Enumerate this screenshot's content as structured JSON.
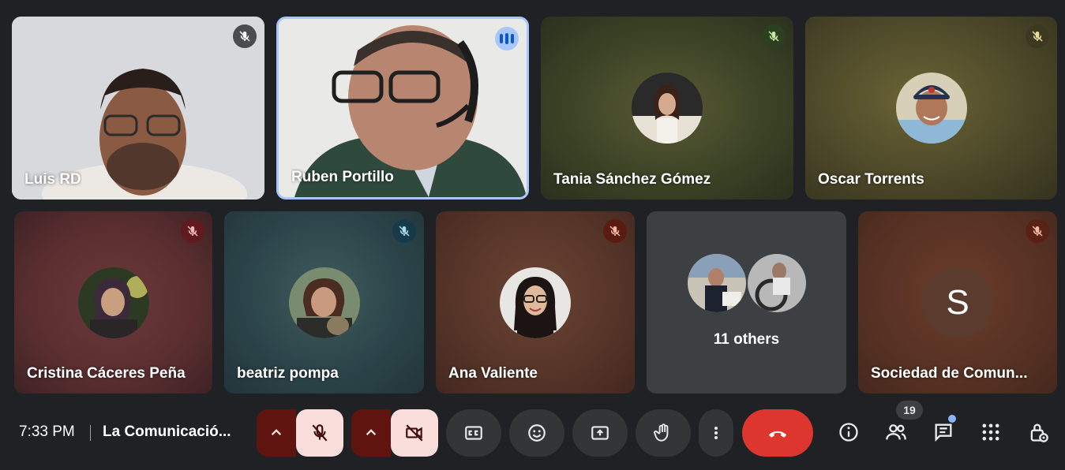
{
  "participants_row1": [
    {
      "name": "Luis RD",
      "muted": true
    },
    {
      "name": "Ruben Portillo",
      "speaking": true
    },
    {
      "name": "Tania Sánchez Gómez",
      "muted": true
    },
    {
      "name": "Oscar Torrents",
      "muted": true
    }
  ],
  "participants_row2": [
    {
      "name": "Cristina Cáceres Peña",
      "muted": true
    },
    {
      "name": "beatriz pompa",
      "muted": true
    },
    {
      "name": "Ana Valiente",
      "muted": true
    },
    {
      "name": "Sociedad de Comun...",
      "muted": true,
      "initial": "S"
    }
  ],
  "others": {
    "label": "11 others"
  },
  "bottom_bar": {
    "time": "7:33 PM",
    "meeting_name": "La Comunicació...",
    "participants_count": "19"
  },
  "colors": {
    "background": "#202124",
    "mic_off_red": "#f9dedc",
    "hangup_red": "#dc362e",
    "speaking_blue": "#a8c7fa"
  },
  "icons": {
    "mic": "microphone-off-icon",
    "camera": "camera-off-icon",
    "captions": "closed-captions-icon",
    "emoji": "emoji-icon",
    "present": "present-screen-icon",
    "hand": "raise-hand-icon",
    "more": "more-options-icon",
    "hangup": "hang-up-icon",
    "info": "info-icon",
    "people": "people-icon",
    "chat": "chat-icon",
    "activities": "activities-icon",
    "host": "host-controls-icon"
  }
}
